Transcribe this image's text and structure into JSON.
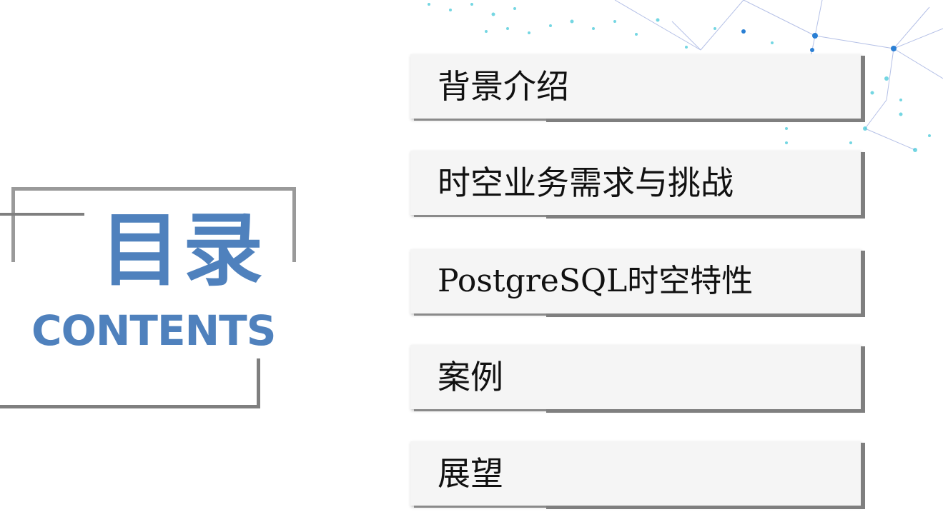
{
  "title": {
    "cn": "目录",
    "en": "CONTENTS"
  },
  "menu": {
    "items": [
      {
        "label": "背景介绍"
      },
      {
        "label": "时空业务需求与挑战"
      },
      {
        "label": "PostgreSQL时空特性"
      },
      {
        "label": "案例"
      },
      {
        "label": "展望"
      }
    ]
  },
  "colors": {
    "accent": "#4f81bd",
    "frame": "#9a9a9a",
    "card": "#f5f5f5",
    "card_shadow": "#7f7f7f",
    "network_nodes": "#3fd0d0",
    "network_lines": "#3a5fcd"
  }
}
